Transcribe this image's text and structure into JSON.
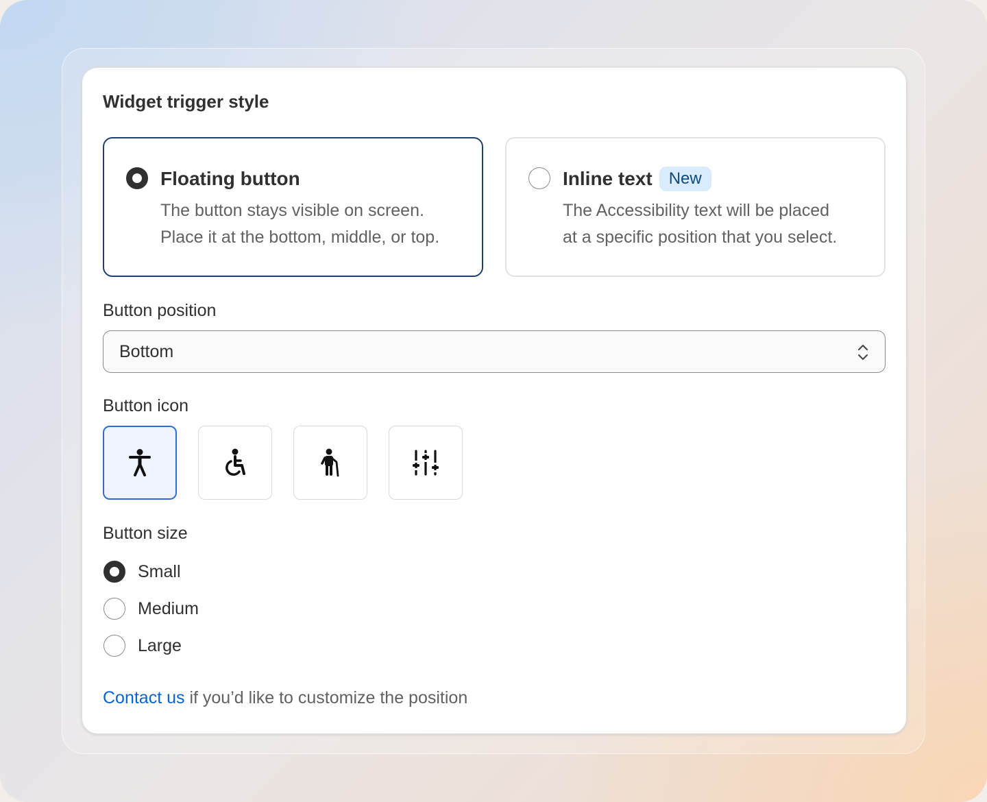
{
  "card": {
    "title": "Widget trigger style"
  },
  "trigger_options": [
    {
      "title": "Floating button",
      "description_line1": "The button stays visible on screen.",
      "description_line2": "Place it at the bottom, middle, or top.",
      "selected": true
    },
    {
      "title": "Inline text",
      "badge": "New",
      "description_line1": "The Accessibility text will be placed",
      "description_line2": "at a specific position that you select.",
      "selected": false
    }
  ],
  "position": {
    "label": "Button position",
    "value": "Bottom"
  },
  "icon": {
    "label": "Button icon",
    "options": [
      "accessibility-person-icon",
      "wheelchair-icon",
      "elderly-person-icon",
      "sliders-icon"
    ],
    "selected_index": 0
  },
  "size": {
    "label": "Button size",
    "options": [
      "Small",
      "Medium",
      "Large"
    ],
    "selected": "Small"
  },
  "footer": {
    "link": "Contact us",
    "text": " if you’d like to customize the position"
  },
  "colors": {
    "selected_border": "#1c3f6e",
    "icon_selected_border": "#2f6bd4",
    "link": "#0b63ce",
    "badge_bg": "#d9ecff"
  }
}
